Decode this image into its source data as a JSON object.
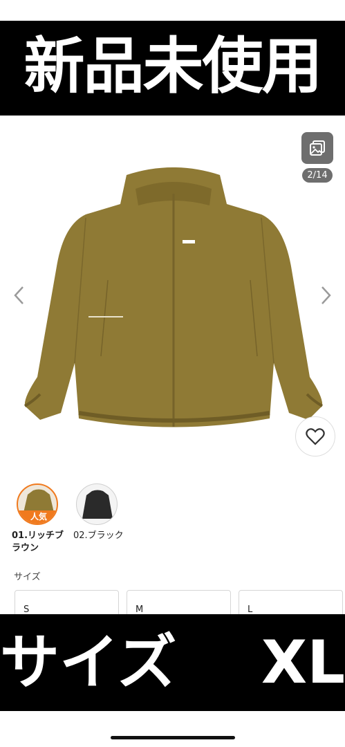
{
  "top_banner": {
    "text": "新品未使用"
  },
  "gallery": {
    "counter": "2/14"
  },
  "colors": [
    {
      "label": "01.リッチブラウン",
      "badge": "人気"
    },
    {
      "label": "02.ブラック"
    }
  ],
  "size_section": {
    "heading": "サイズ",
    "options": [
      "S",
      "M",
      "L"
    ]
  },
  "bottom_banner": {
    "left": "サイズ",
    "right": "XL"
  },
  "theme": {
    "accent": "#f07a1e",
    "jacket": "#8f7a35",
    "banner": "#000000"
  }
}
